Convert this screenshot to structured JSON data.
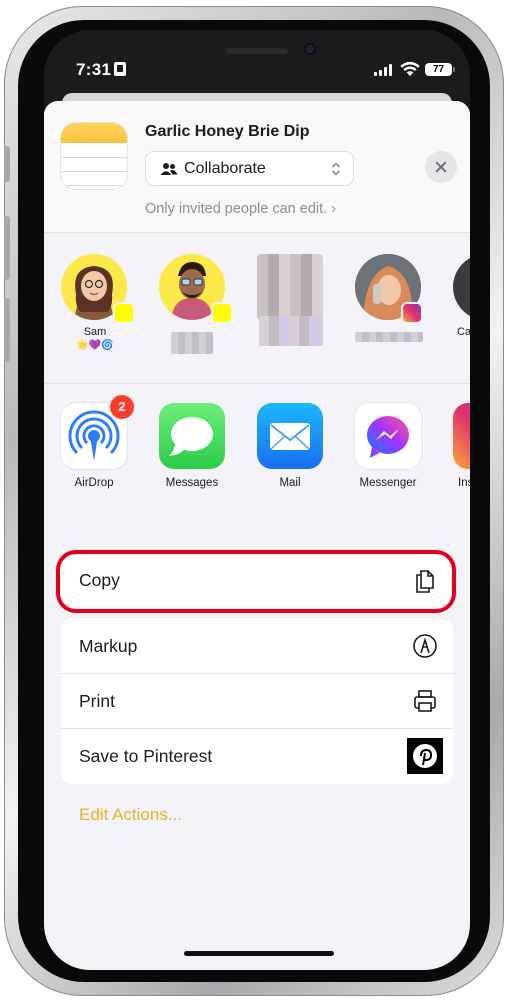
{
  "status_bar": {
    "time": "7:31",
    "battery": "77"
  },
  "share_sheet": {
    "document_title": "Garlic Honey Brie Dip",
    "collaborate_label": "Collaborate",
    "invite_note": "Only invited people can edit. ›"
  },
  "people": [
    {
      "name": "Sam",
      "emoji": "🌟💜🌀",
      "badge": "snapchat"
    },
    {
      "name": "",
      "badge": "snapchat"
    },
    {
      "name": "",
      "badge": ""
    },
    {
      "name": "",
      "badge": "instagram"
    },
    {
      "name": "Ca"
    }
  ],
  "apps": [
    {
      "label": "AirDrop",
      "badge_count": "2"
    },
    {
      "label": "Messages"
    },
    {
      "label": "Mail"
    },
    {
      "label": "Messenger"
    },
    {
      "label": "Ins"
    }
  ],
  "actions_primary": [
    {
      "label": "Copy"
    }
  ],
  "actions_secondary": [
    {
      "label": "Markup"
    },
    {
      "label": "Print"
    },
    {
      "label": "Save to Pinterest"
    }
  ],
  "edit_actions_label": "Edit Actions...",
  "colors": {
    "accent": "#e9b12c",
    "highlight": "#e3001b",
    "sheet_bg": "#f2f2f7"
  }
}
